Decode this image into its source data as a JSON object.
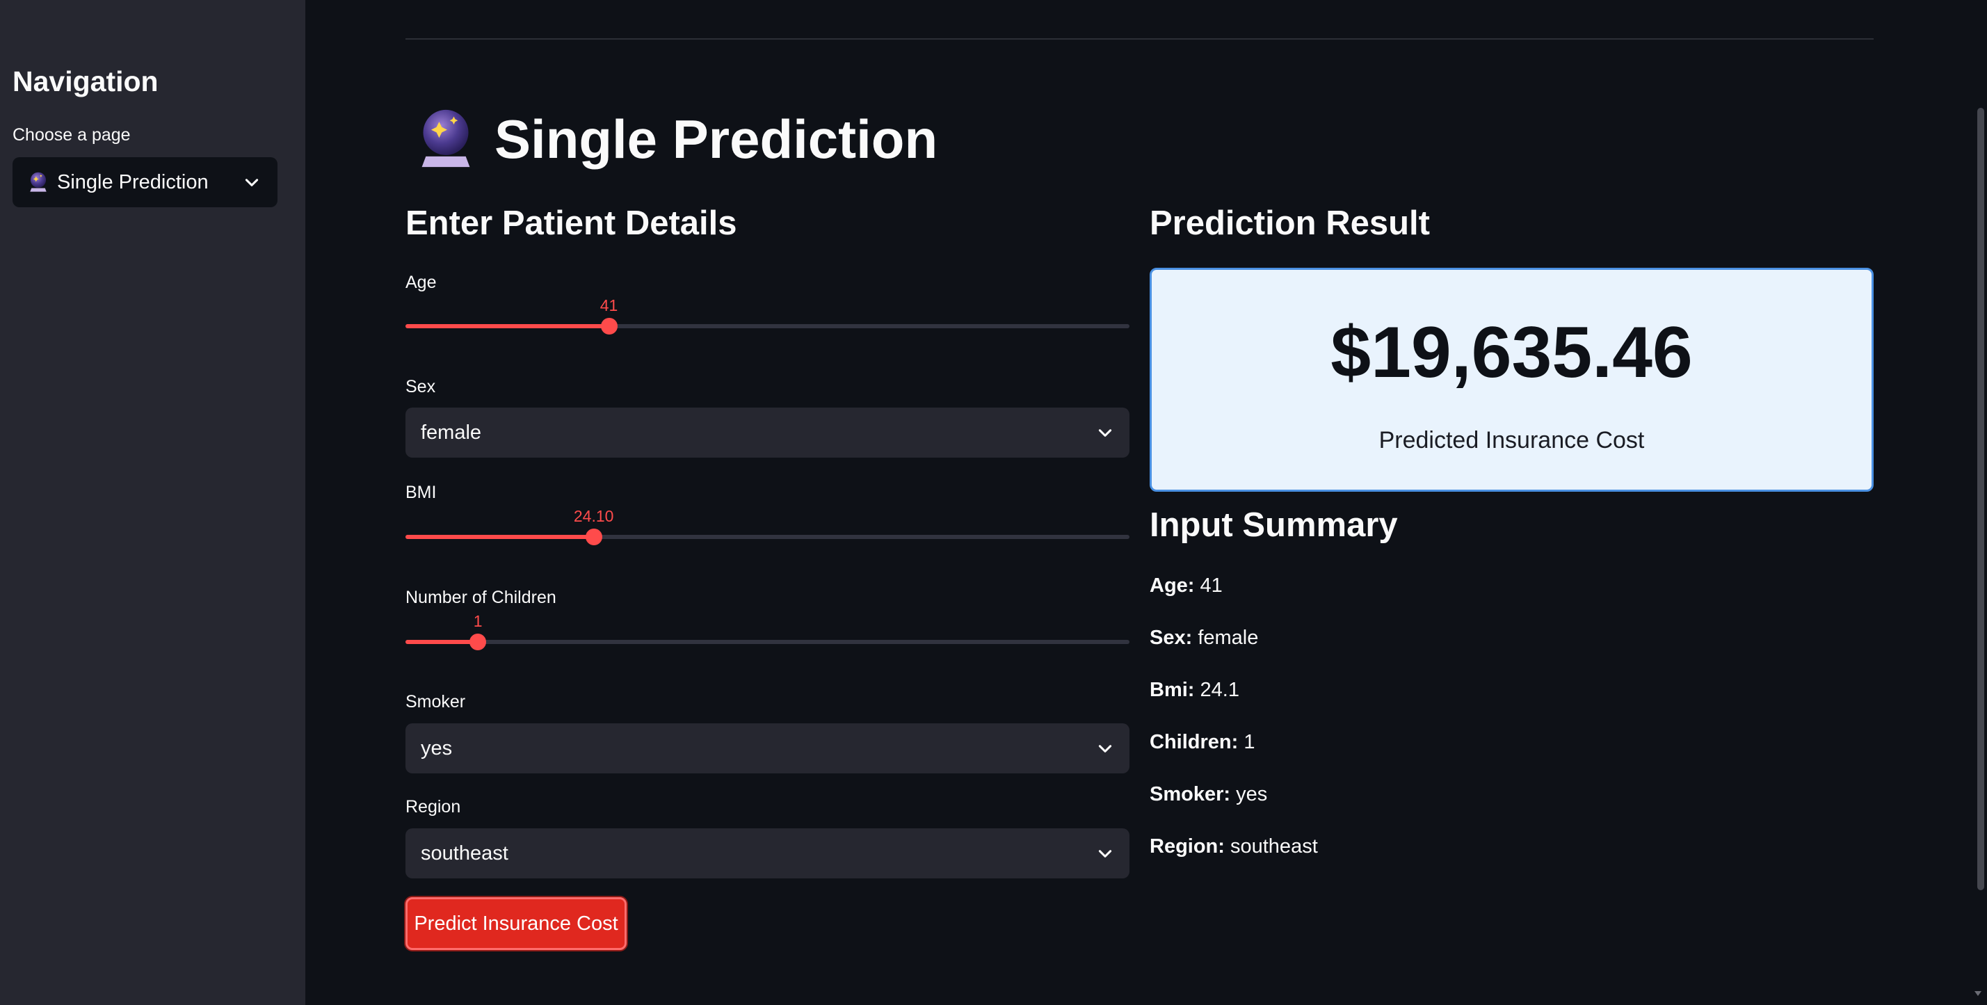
{
  "sidebar": {
    "title": "Navigation",
    "select_label": "Choose a page",
    "selected_page": "Single Prediction"
  },
  "page": {
    "title": "Single Prediction",
    "icon": "crystal-ball-icon"
  },
  "form": {
    "header": "Enter Patient Details",
    "age": {
      "label": "Age",
      "value": "41",
      "fraction": 0.281
    },
    "sex": {
      "label": "Sex",
      "value": "female"
    },
    "bmi": {
      "label": "BMI",
      "value": "24.10",
      "fraction": 0.26
    },
    "children": {
      "label": "Number of Children",
      "value": "1",
      "fraction": 0.1
    },
    "smoker": {
      "label": "Smoker",
      "value": "yes"
    },
    "region": {
      "label": "Region",
      "value": "southeast"
    },
    "button_label": "Predict Insurance Cost"
  },
  "result": {
    "header": "Prediction Result",
    "value": "$19,635.46",
    "caption": "Predicted Insurance Cost"
  },
  "summary": {
    "header": "Input Summary",
    "items": [
      {
        "key": "Age:",
        "value": " 41"
      },
      {
        "key": "Sex:",
        "value": " female"
      },
      {
        "key": "Bmi:",
        "value": " 24.1"
      },
      {
        "key": "Children:",
        "value": " 1"
      },
      {
        "key": "Smoker:",
        "value": " yes"
      },
      {
        "key": "Region:",
        "value": " southeast"
      }
    ]
  },
  "colors": {
    "accent": "#ff4b4b",
    "button": "#e0281f",
    "card_bg": "#e9f3fd",
    "card_border": "#4a90e2"
  }
}
